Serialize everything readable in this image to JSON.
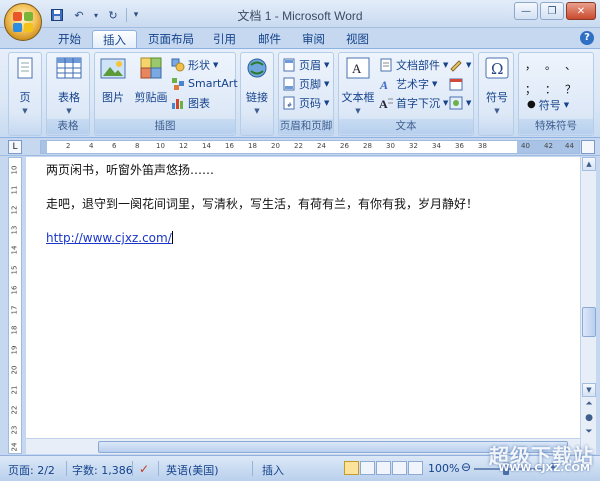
{
  "window": {
    "title": "文档 1 - Microsoft Word",
    "minimize": "—",
    "restore": "❐",
    "close": "✕"
  },
  "quick_access": {
    "save_icon": "save-icon",
    "undo": "↶",
    "redo": "↻",
    "customize": "▾"
  },
  "tabs": [
    "开始",
    "插入",
    "页面布局",
    "引用",
    "邮件",
    "审阅",
    "视图"
  ],
  "active_tab": "插入",
  "help": "?",
  "ribbon": {
    "groups": {
      "pages": {
        "label": "",
        "button": "页"
      },
      "tables": {
        "label": "表格",
        "button": "表格"
      },
      "illustrations": {
        "label": "插图",
        "picture": "图片",
        "clipart": "剪贴画",
        "shapes": "形状",
        "smartart": "SmartArt",
        "chart": "图表"
      },
      "links": {
        "label": "",
        "button": "链接"
      },
      "header_footer": {
        "label": "页眉和页脚",
        "header": "页眉",
        "footer": "页脚",
        "page_number": "页码"
      },
      "text": {
        "label": "文本",
        "textbox": "文本框",
        "quickparts": "文档部件",
        "wordart": "艺术字",
        "dropcap": "首字下沉"
      },
      "symbols": {
        "label": "",
        "button": "符号"
      },
      "special": {
        "label": "特殊符号",
        "chars": [
          "，",
          "。",
          "、",
          "；",
          "：",
          "？"
        ],
        "more": "符号"
      }
    }
  },
  "ruler": {
    "numbers": [
      "2",
      "4",
      "6",
      "8",
      "10",
      "12",
      "14",
      "16",
      "18",
      "20",
      "22",
      "24",
      "26",
      "28",
      "30",
      "32",
      "34",
      "36",
      "38",
      "40",
      "42",
      "44"
    ],
    "vertical_numbers": [
      "10",
      "11",
      "12",
      "13",
      "14",
      "15",
      "16",
      "17",
      "18",
      "19",
      "20",
      "21",
      "22",
      "23",
      "24"
    ]
  },
  "document": {
    "line1": "两页闲书，听窗外笛声悠扬……",
    "line2": "走吧，退守到一阕花间词里，写清秋，写生活，有荷有兰，有你有我，岁月静好！",
    "link": "http://www.cjxz.com/"
  },
  "status": {
    "page": "页面: 2/2",
    "words": "字数: 1,386",
    "language": "英语(美国)",
    "mode": "插入",
    "zoom": "100%",
    "zoom_minus": "⊖",
    "zoom_plus": "⊕"
  },
  "watermark": {
    "text": "超级下载站",
    "sub": "WWW.CJXZ.COM"
  },
  "colors": {
    "ribbon": "#dbe7f6",
    "accent": "#15428b",
    "link": "#1a36c9"
  }
}
